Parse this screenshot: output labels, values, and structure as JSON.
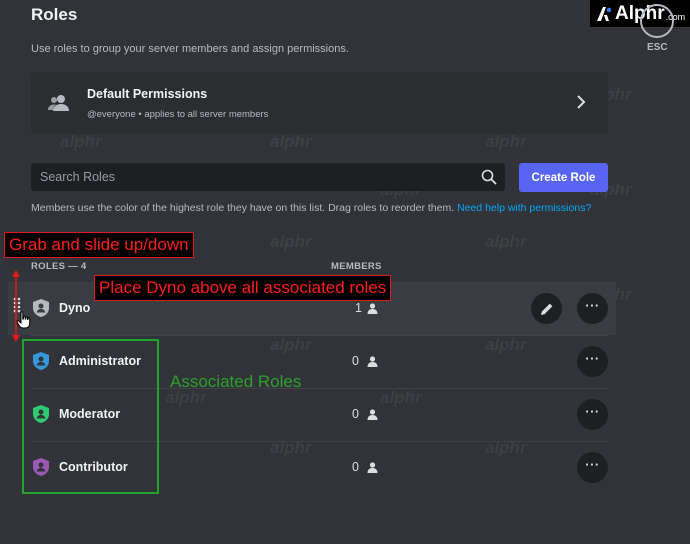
{
  "header": {
    "title": "Roles",
    "subtitle": "Use roles to group your server members and assign permissions."
  },
  "logo": {
    "text": "Alphr",
    "domain": ".com"
  },
  "esc": {
    "label": "ESC"
  },
  "default_permissions": {
    "title": "Default Permissions",
    "subtitle": "@everyone • applies to all server members"
  },
  "search": {
    "placeholder": "Search Roles"
  },
  "create_role": {
    "label": "Create Role"
  },
  "hint": {
    "text": "Members use the color of the highest role they have on this list. Drag roles to reorder them. ",
    "link": "Need help with permissions?"
  },
  "columns": {
    "roles": "ROLES — 4",
    "members": "MEMBERS"
  },
  "roles": [
    {
      "name": "Dyno",
      "members": "1",
      "color": "#b5bac1"
    },
    {
      "name": "Administrator",
      "members": "0",
      "color": "#3498db"
    },
    {
      "name": "Moderator",
      "members": "0",
      "color": "#2ecc71"
    },
    {
      "name": "Contributor",
      "members": "0",
      "color": "#9b59b6"
    }
  ],
  "annotations": {
    "grab": "Grab and slide up/down",
    "place": "Place Dyno above all associated roles",
    "associated": "Associated Roles"
  },
  "watermark": "alphr",
  "colors": {
    "accent": "#5865f2",
    "link": "#00a8fc",
    "annotation_red": "#ff1f1f",
    "annotation_green": "#2ca02c"
  }
}
